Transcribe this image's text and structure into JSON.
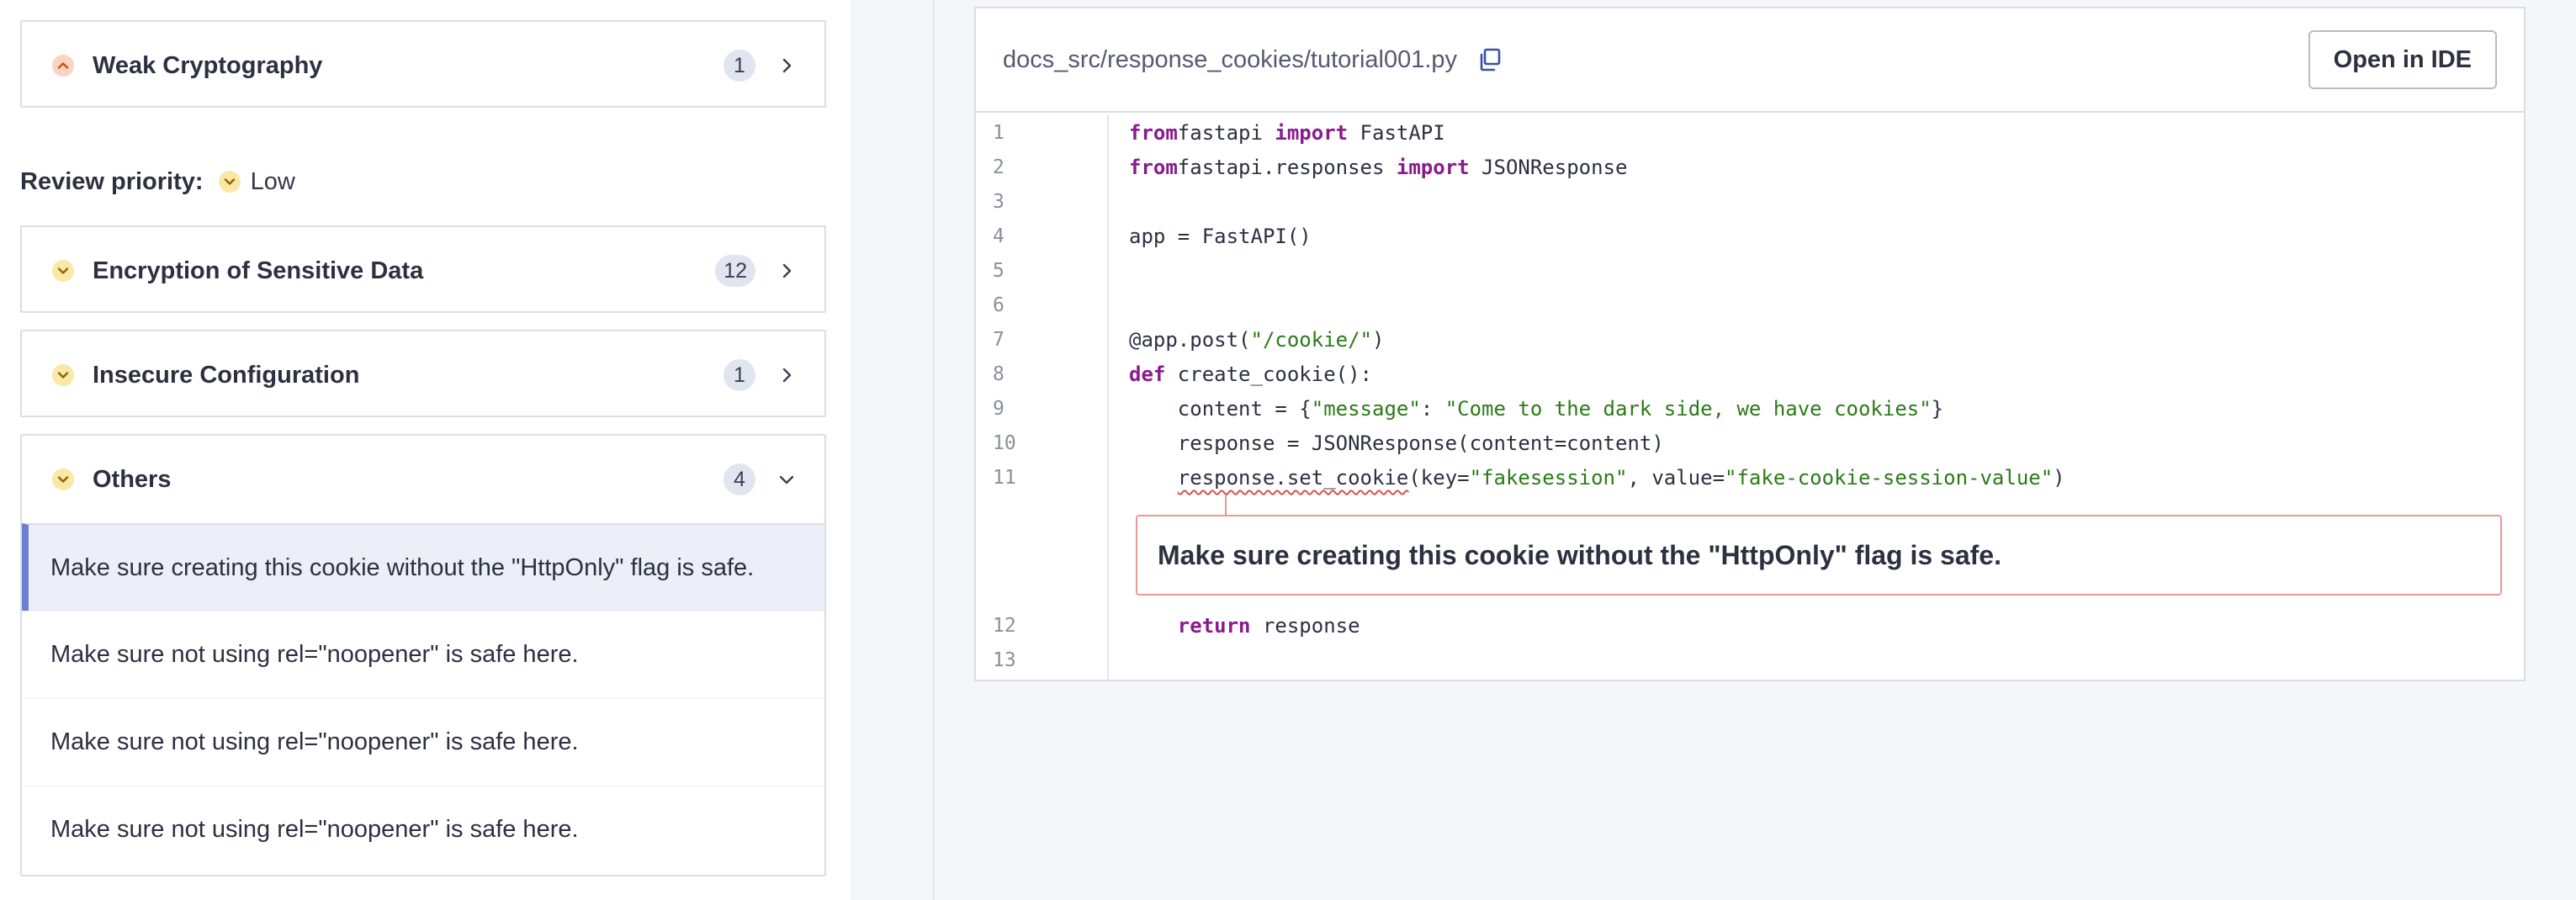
{
  "left_panel": {
    "weak_crypto": {
      "title": "Weak Cryptography",
      "count": "1"
    },
    "review_priority": {
      "label": "Review priority:",
      "value": "Low"
    },
    "encryption": {
      "title": "Encryption of Sensitive Data",
      "count": "12"
    },
    "insecure_config": {
      "title": "Insecure Configuration",
      "count": "1"
    },
    "others": {
      "title": "Others",
      "count": "4",
      "items": [
        {
          "text": "Make sure creating this cookie without the \"HttpOnly\" flag is safe."
        },
        {
          "text": "Make sure not using rel=\"noopener\" is safe here."
        },
        {
          "text": "Make sure not using rel=\"noopener\" is safe here."
        },
        {
          "text": "Make sure not using rel=\"noopener\" is safe here."
        }
      ]
    }
  },
  "code_viewer": {
    "file_path": "docs_src/response_cookies/tutorial001.py",
    "open_ide_label": "Open in IDE",
    "issue_message": "Make sure creating this cookie without the \"HttpOnly\" flag is safe.",
    "lines": [
      {
        "n": "1",
        "tokens": [
          [
            "kw",
            "from"
          ],
          [
            "",
            "fastapi "
          ],
          [
            "kw",
            "import"
          ],
          [
            "",
            " FastAPI"
          ]
        ]
      },
      {
        "n": "2",
        "tokens": [
          [
            "kw",
            "from"
          ],
          [
            "",
            "fastapi.responses "
          ],
          [
            "kw",
            "import"
          ],
          [
            "",
            " JSONResponse"
          ]
        ]
      },
      {
        "n": "3",
        "tokens": []
      },
      {
        "n": "4",
        "tokens": [
          [
            "",
            "app = FastAPI()"
          ]
        ]
      },
      {
        "n": "5",
        "tokens": []
      },
      {
        "n": "6",
        "tokens": []
      },
      {
        "n": "7",
        "tokens": [
          [
            "",
            "@app.post("
          ],
          [
            "str",
            "\"/cookie/\""
          ],
          [
            "",
            ")"
          ]
        ]
      },
      {
        "n": "8",
        "tokens": [
          [
            "kw",
            "def"
          ],
          [
            "",
            " create_cookie():"
          ]
        ]
      },
      {
        "n": "9",
        "tokens": [
          [
            "",
            "    content = {"
          ],
          [
            "str",
            "\"message\""
          ],
          [
            "",
            ": "
          ],
          [
            "str",
            "\"Come to the dark side, we have cookies\""
          ],
          [
            "",
            "}"
          ]
        ]
      },
      {
        "n": "10",
        "tokens": [
          [
            "",
            "    response = JSONResponse(content=content)"
          ]
        ]
      },
      {
        "n": "11",
        "tokens": [
          [
            "",
            "    "
          ],
          [
            "sq",
            "response.set_cookie"
          ],
          [
            "",
            "(key="
          ],
          [
            "str",
            "\"fakesession\""
          ],
          [
            "",
            ", value="
          ],
          [
            "str",
            "\"fake-cookie-session-value\""
          ],
          [
            "",
            ")"
          ]
        ]
      },
      {
        "n": "12",
        "tokens": [
          [
            "",
            "    "
          ],
          [
            "kw",
            "return"
          ],
          [
            "",
            " response"
          ]
        ]
      },
      {
        "n": "13",
        "tokens": []
      }
    ]
  }
}
